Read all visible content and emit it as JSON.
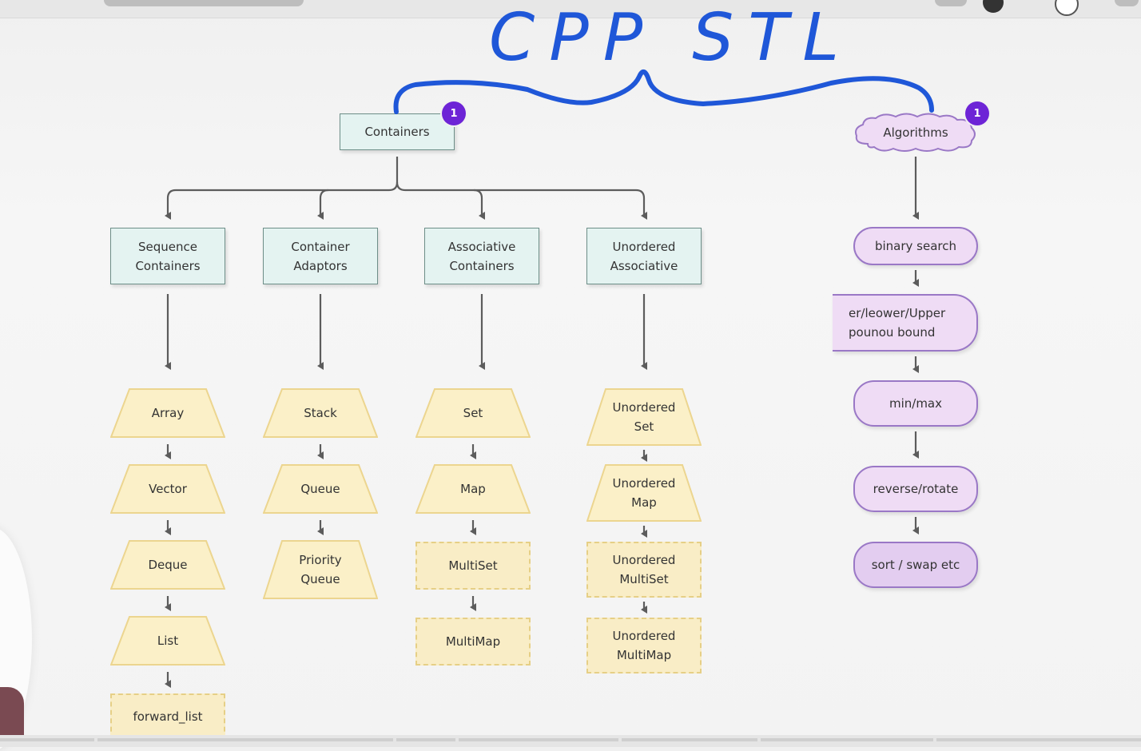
{
  "handwritten_title": "CPP STL",
  "badge_number": "1",
  "nodes": {
    "containers": "Containers",
    "algorithms": "Algorithms",
    "sequence": "Sequence\nContainers",
    "adaptors": "Container\nAdaptors",
    "associative": "Associative\nContainers",
    "unordered": "Unordered\nAssociative",
    "array": "Array",
    "vector": "Vector",
    "deque": "Deque",
    "list": "List",
    "forward_list": "forward_list",
    "stack": "Stack",
    "queue": "Queue",
    "priority_queue": "Priority\nQueue",
    "set": "Set",
    "map": "Map",
    "multiset": "MultiSet",
    "multimap": "MultiMap",
    "unordered_set": "Unordered\nSet",
    "unordered_map": "Unordered\nMap",
    "unordered_multiset": "Unordered\nMultiSet",
    "unordered_multimap": "Unordered\nMultiMap",
    "binary_search": "binary search",
    "bound": "er/leower/Upper\npounou bound",
    "minmax": "min/max",
    "reverse_rotate": "reverse/rotate",
    "sort_swap": "sort / swap etc"
  },
  "colors": {
    "container_fill": "#e4f3f1",
    "container_border": "#6d8e88",
    "trap_fill": "#fbf0c8",
    "trap_border": "#ecd58f",
    "pill_fill": "#efdcf5",
    "pill_border": "#9a78c6",
    "badge": "#6d24d6",
    "handwriting": "#1f57d8",
    "edge": "#5c5c5c"
  }
}
